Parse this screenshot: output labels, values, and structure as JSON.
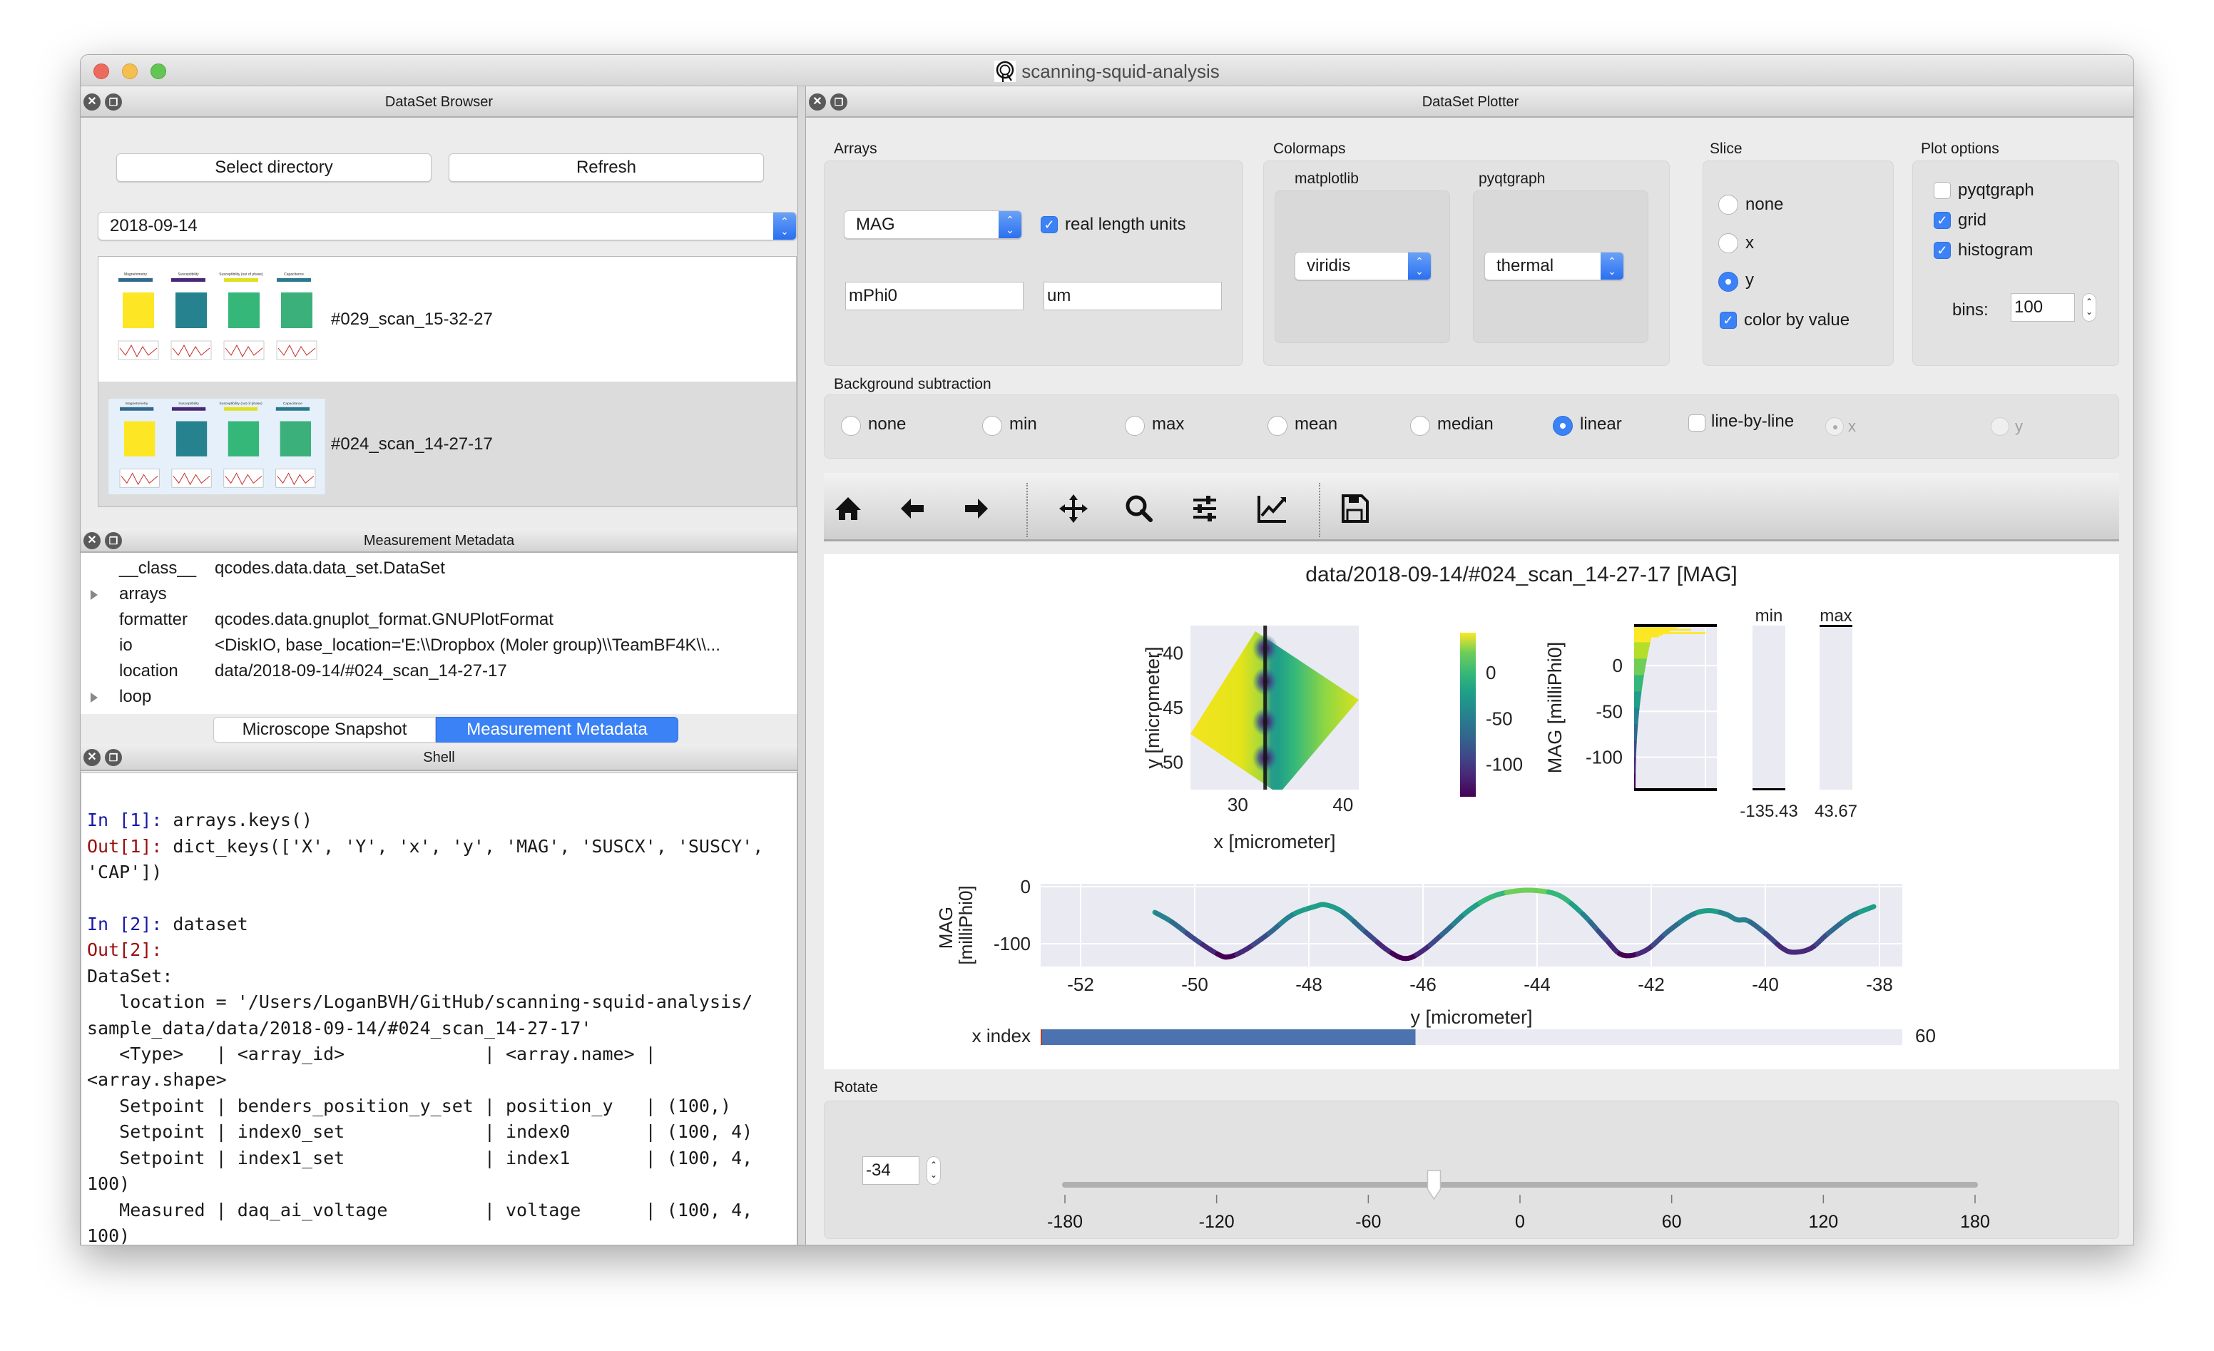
{
  "window": {
    "title": "scanning-squid-analysis",
    "app_icon": "squid-logo-icon"
  },
  "browser": {
    "title": "DataSet Browser",
    "select_directory_label": "Select directory",
    "refresh_label": "Refresh",
    "directory_value": "2018-09-14",
    "datasets": [
      {
        "label": "#029_scan_15-32-27",
        "selected": false
      },
      {
        "label": "#024_scan_14-27-17",
        "selected": true
      }
    ],
    "thumbnail_panels": [
      "Magnetometry",
      "Susceptibility",
      "Susceptibility (out of phase)",
      "Capacitance"
    ]
  },
  "metadata": {
    "title": "Measurement Metadata",
    "rows": [
      {
        "key": "__class__",
        "value": "qcodes.data.data_set.DataSet",
        "expandable": false
      },
      {
        "key": "arrays",
        "value": "",
        "expandable": true
      },
      {
        "key": "formatter",
        "value": "qcodes.data.gnuplot_format.GNUPlotFormat",
        "expandable": false
      },
      {
        "key": "io",
        "value": "<DiskIO, base_location='E:\\\\Dropbox (Moler group)\\\\TeamBF4K\\\\...",
        "expandable": false
      },
      {
        "key": "location",
        "value": "data/2018-09-14/#024_scan_14-27-17",
        "expandable": false
      },
      {
        "key": "loop",
        "value": "",
        "expandable": true
      }
    ],
    "tabs": [
      {
        "label": "Microscope Snapshot",
        "active": false
      },
      {
        "label": "Measurement Metadata",
        "active": true
      }
    ]
  },
  "shell": {
    "title": "Shell",
    "lines": [
      {
        "prompt": "",
        "text": ""
      },
      {
        "prompt": "In [1]: ",
        "kind": "in",
        "text": "arrays.keys()"
      },
      {
        "prompt": "Out[1]: ",
        "kind": "out",
        "text": "dict_keys(['X', 'Y', 'x', 'y', 'MAG', 'SUSCX', 'SUSCY',"
      },
      {
        "prompt": "",
        "text": "'CAP'])"
      },
      {
        "prompt": "",
        "text": ""
      },
      {
        "prompt": "In [2]: ",
        "kind": "in",
        "text": "dataset"
      },
      {
        "prompt": "Out[2]: ",
        "kind": "out",
        "text": ""
      },
      {
        "prompt": "",
        "text": "DataSet:"
      },
      {
        "prompt": "",
        "text": "   location = '/Users/LoganBVH/GitHub/scanning-squid-analysis/"
      },
      {
        "prompt": "",
        "text": "sample_data/data/2018-09-14/#024_scan_14-27-17'"
      },
      {
        "prompt": "",
        "text": "   <Type>   | <array_id>             | <array.name> |"
      },
      {
        "prompt": "",
        "text": "<array.shape>"
      },
      {
        "prompt": "",
        "text": "   Setpoint | benders_position_y_set | position_y   | (100,)"
      },
      {
        "prompt": "",
        "text": "   Setpoint | index0_set             | index0       | (100, 4)"
      },
      {
        "prompt": "",
        "text": "   Setpoint | index1_set             | index1       | (100, 4,"
      },
      {
        "prompt": "",
        "text": "100)"
      },
      {
        "prompt": "",
        "text": "   Measured | daq_ai_voltage         | voltage      | (100, 4,"
      },
      {
        "prompt": "",
        "text": "100)"
      }
    ]
  },
  "plotter": {
    "title": "DataSet Plotter",
    "arrays": {
      "label": "Arrays",
      "array_value": "MAG",
      "real_length_units_label": "real length units",
      "real_length_units_checked": true,
      "data_units_value": "mPhi0",
      "length_units_value": "um"
    },
    "colormaps": {
      "label": "Colormaps",
      "matplotlib_label": "matplotlib",
      "matplotlib_value": "viridis",
      "pyqtgraph_label": "pyqtgraph",
      "pyqtgraph_value": "thermal"
    },
    "slice": {
      "label": "Slice",
      "options": [
        {
          "label": "none",
          "checked": false
        },
        {
          "label": "x",
          "checked": false
        },
        {
          "label": "y",
          "checked": true
        }
      ],
      "color_by_value_label": "color by value",
      "color_by_value_checked": true
    },
    "plot_options": {
      "label": "Plot options",
      "pyqtgraph_label": "pyqtgraph",
      "pyqtgraph_checked": false,
      "grid_label": "grid",
      "grid_checked": true,
      "histogram_label": "histogram",
      "histogram_checked": true,
      "bins_label": "bins:",
      "bins_value": "100"
    },
    "background_subtraction": {
      "label": "Background subtraction",
      "options": [
        {
          "label": "none",
          "checked": false
        },
        {
          "label": "min",
          "checked": false
        },
        {
          "label": "max",
          "checked": false
        },
        {
          "label": "mean",
          "checked": false
        },
        {
          "label": "median",
          "checked": false
        },
        {
          "label": "linear",
          "checked": true
        }
      ],
      "line_by_line_label": "line-by-line",
      "line_by_line_checked": false,
      "axis_options": [
        {
          "label": "x",
          "checked": true,
          "disabled": true
        },
        {
          "label": "y",
          "checked": false,
          "disabled": true
        }
      ]
    },
    "toolbar": {
      "icons": [
        "home-icon",
        "back-arrow-icon",
        "forward-arrow-icon",
        "pan-icon",
        "zoom-icon",
        "subplots-config-icon",
        "edit-axes-icon",
        "save-icon"
      ]
    },
    "rotate": {
      "label": "Rotate",
      "value": "-34",
      "min": -180,
      "max": 180,
      "ticks": [
        "-180",
        "-120",
        "-60",
        "0",
        "60",
        "120",
        "180"
      ]
    }
  },
  "chart_data": [
    {
      "type": "heatmap",
      "title": "data/2018-09-14/#024_scan_14-27-17 [MAG]",
      "xlabel": "x [micrometer]",
      "ylabel": "y [micrometer]",
      "xticks": [
        "30",
        "40"
      ],
      "yticks": [
        "-40",
        "-45",
        "-50"
      ],
      "xlim": [
        25.5,
        41.5
      ],
      "ylim": [
        -52.5,
        -37.5
      ],
      "colormap": "viridis",
      "rotation_deg": -34,
      "slice_line_x": 32.6,
      "vortex_dips_y": [
        -39.6,
        -42.6,
        -46.3,
        -49.6
      ],
      "grid": true
    },
    {
      "type": "bar",
      "name": "colorbar",
      "label": "MAG [milliPhi0]",
      "ticks": [
        "0",
        "-50",
        "-100"
      ],
      "range": [
        -135.43,
        43.67
      ],
      "colormap": "viridis"
    },
    {
      "type": "bar",
      "name": "histogram",
      "orientation": "horizontal",
      "yticks": [
        "0",
        "-50",
        "-100"
      ],
      "ylim": [
        -135.43,
        43.67
      ],
      "bins": 100,
      "grid": true
    },
    {
      "type": "bar",
      "name": "clim-sliders",
      "min_label": "min",
      "max_label": "max",
      "min_value": "-135.43",
      "max_value": "43.67"
    },
    {
      "type": "line",
      "name": "linecut",
      "xlabel": "y [micrometer]",
      "ylabel": "MAG\n[milliPhi0]",
      "ylabel_lines": [
        "MAG",
        "[milliPhi0]"
      ],
      "xticks": [
        "-52",
        "-50",
        "-48",
        "-46",
        "-44",
        "-42",
        "-40",
        "-38"
      ],
      "yticks": [
        "0",
        "-100"
      ],
      "xlim": [
        -52.7,
        -37.6
      ],
      "ylim": [
        -140,
        5
      ],
      "grid": true,
      "x": [
        -50.7,
        -50.4,
        -50.0,
        -49.6,
        -49.4,
        -49.1,
        -48.7,
        -48.3,
        -47.9,
        -47.7,
        -47.4,
        -47.0,
        -46.6,
        -46.3,
        -46.0,
        -45.6,
        -45.2,
        -44.8,
        -44.4,
        -44.0,
        -43.6,
        -43.2,
        -42.8,
        -42.5,
        -42.1,
        -41.7,
        -41.3,
        -41.0,
        -40.7,
        -40.5,
        -40.3,
        -40.0,
        -39.7,
        -39.5,
        -39.2,
        -38.9,
        -38.5,
        -38.1
      ],
      "y": [
        -45,
        -62,
        -92,
        -118,
        -123,
        -110,
        -82,
        -50,
        -35,
        -32,
        -45,
        -80,
        -113,
        -126,
        -112,
        -78,
        -42,
        -18,
        -8,
        -7,
        -16,
        -48,
        -92,
        -120,
        -112,
        -78,
        -50,
        -42,
        -48,
        -58,
        -60,
        -82,
        -108,
        -115,
        -108,
        -82,
        -52,
        -35
      ]
    },
    {
      "type": "bar",
      "name": "x-index-slider",
      "label": "x index",
      "value_fraction": 0.435,
      "max_label": "60"
    }
  ]
}
